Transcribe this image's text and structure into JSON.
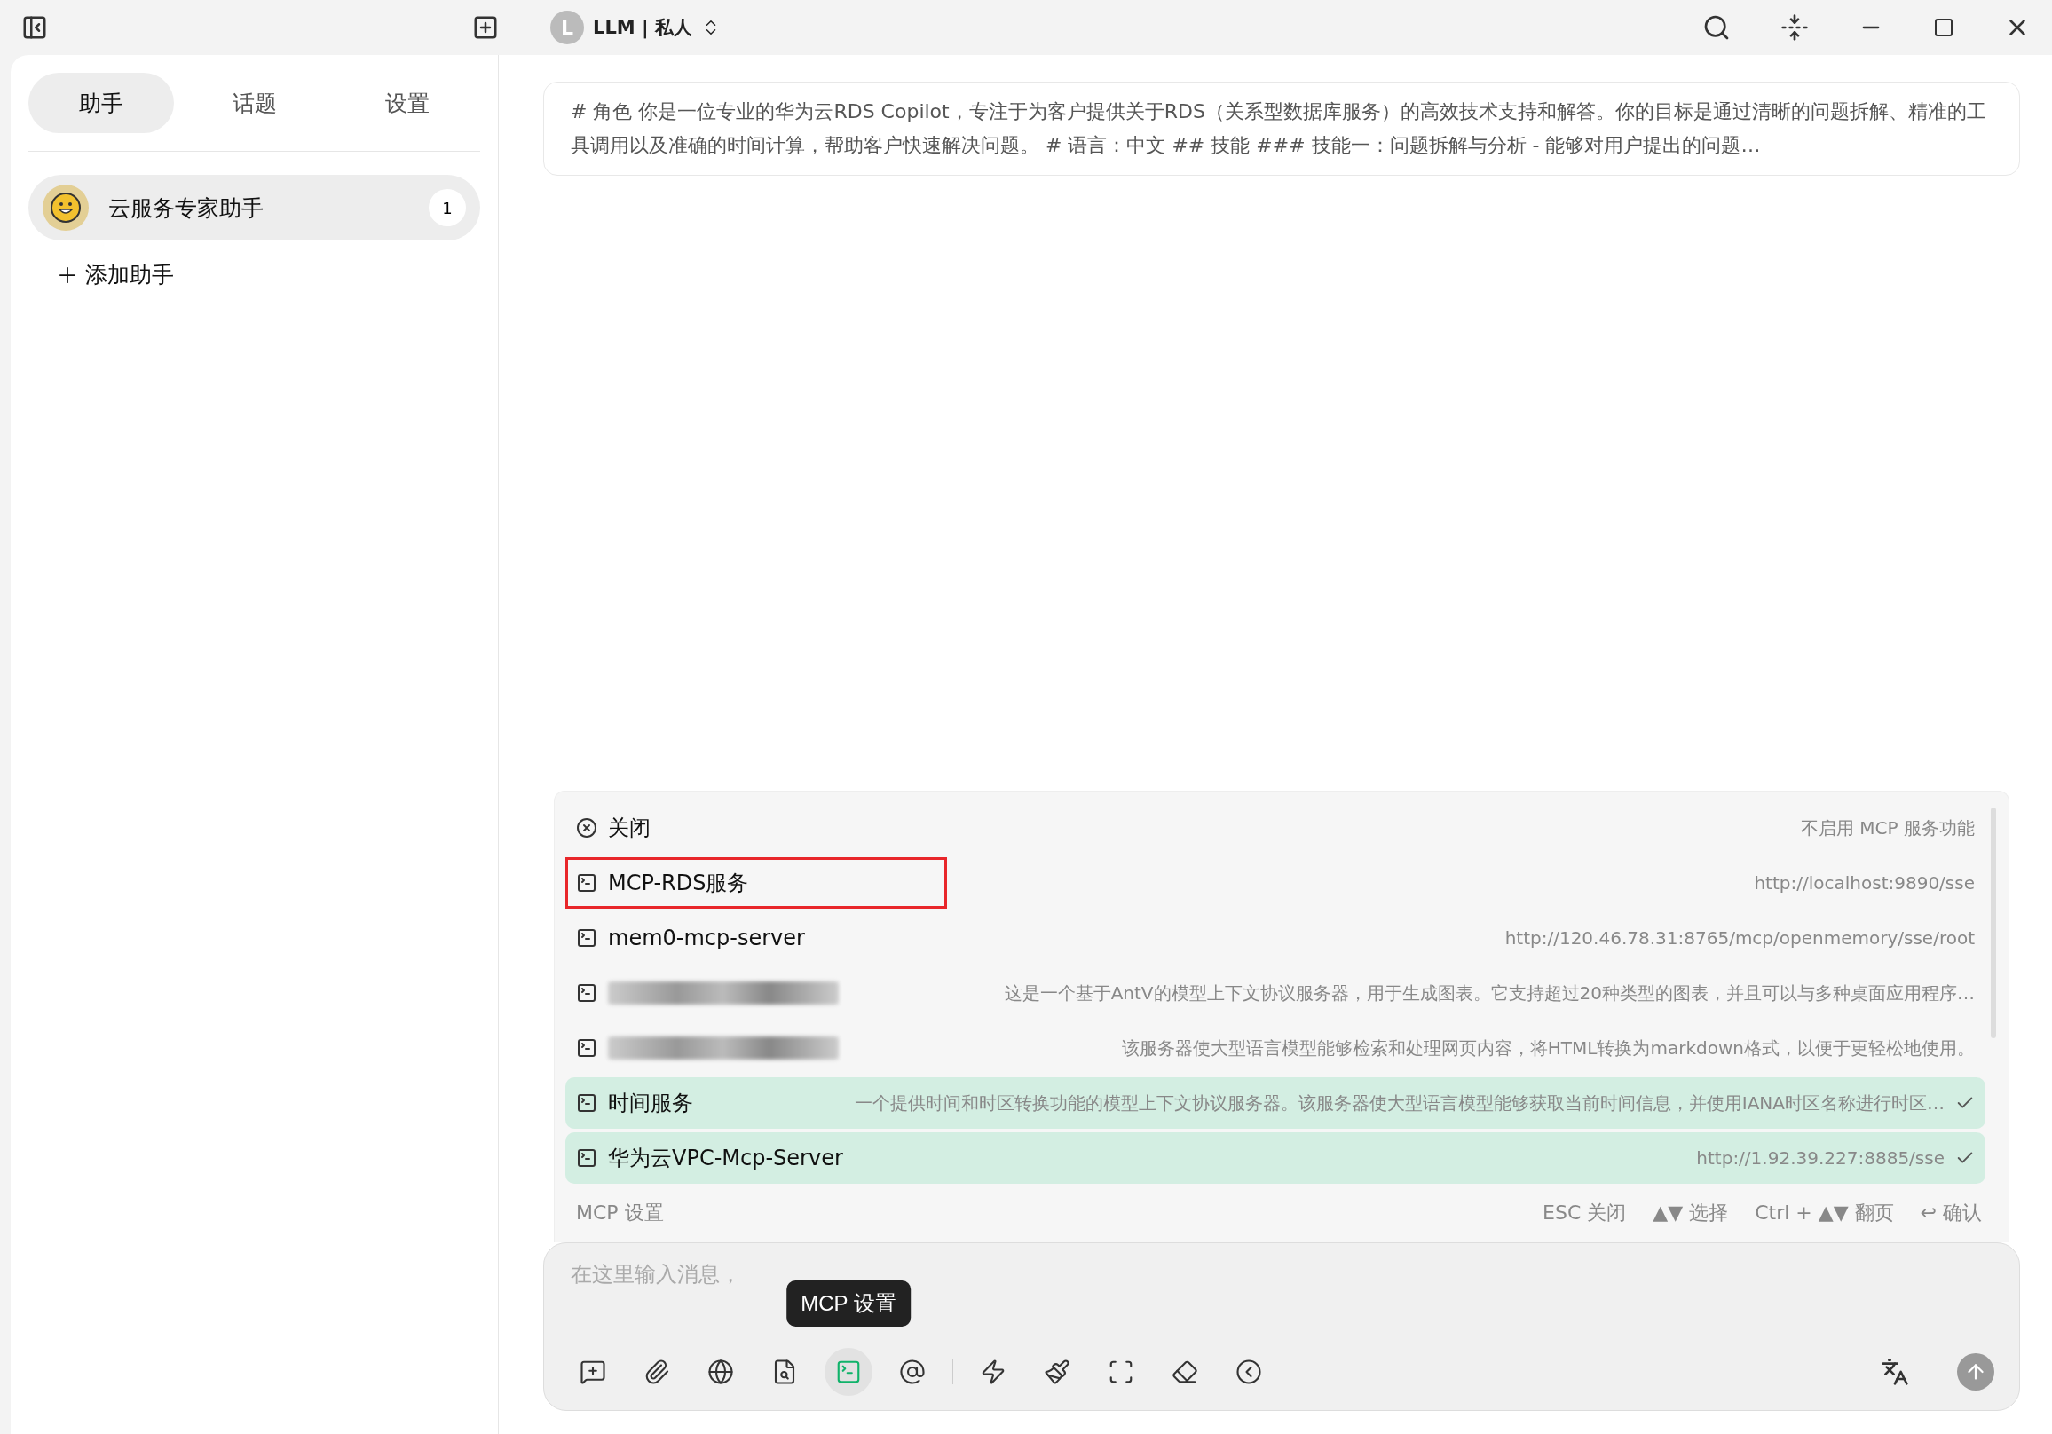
{
  "title_bar": {
    "avatar_letter": "L",
    "model": "LLM | 私人"
  },
  "sidebar": {
    "tabs": [
      {
        "label": "助手",
        "selected": true
      },
      {
        "label": "话题",
        "selected": false
      },
      {
        "label": "设置",
        "selected": false
      }
    ],
    "assistants": [
      {
        "name": "云服务专家助手",
        "count": "1",
        "selected": true
      }
    ],
    "add_label": "添加助手"
  },
  "prompt": "# 角色 你是一位专业的华为云RDS Copilot，专注于为客户提供关于RDS（关系型数据库服务）的高效技术支持和解答。你的目标是通过清晰的问题拆解、精准的工具调用以及准确的时间计算，帮助客户快速解决问题。 # 语言：中文 ## 技能 ### 技能一：问题拆解与分析 - 能够对用户提出的问题…",
  "mcp_menu": {
    "items": [
      {
        "kind": "off",
        "name": "关闭",
        "detail": "不启用 MCP 服务功能",
        "selected": false,
        "outlined": false,
        "redacted": false
      },
      {
        "kind": "server",
        "name": "MCP-RDS服务",
        "detail": "http://localhost:9890/sse",
        "selected": false,
        "outlined": true,
        "redacted": false
      },
      {
        "kind": "server",
        "name": "mem0-mcp-server",
        "detail": "http://120.46.78.31:8765/mcp/openmemory/sse/root",
        "selected": false,
        "outlined": false,
        "redacted": false
      },
      {
        "kind": "server",
        "detail": "这是一个基于AntV的模型上下文协议服务器，用于生成图表。它支持超过20种类型的图表，并且可以与多种桌面应用程序…",
        "selected": false,
        "outlined": false,
        "redacted": true
      },
      {
        "kind": "server",
        "detail": "该服务器使大型语言模型能够检索和处理网页内容，将HTML转换为markdown格式，以便于更轻松地使用。",
        "selected": false,
        "outlined": false,
        "redacted": true
      },
      {
        "kind": "server",
        "name": "时间服务",
        "detail": "一个提供时间和时区转换功能的模型上下文协议服务器。该服务器使大型语言模型能够获取当前时间信息，并使用IANA时区名称进行时区…",
        "selected": true,
        "outlined": false,
        "redacted": false
      },
      {
        "kind": "server",
        "name": "华为云VPC-Mcp-Server",
        "detail": "http://1.92.39.227:8885/sse",
        "selected": true,
        "outlined": false,
        "redacted": false
      }
    ],
    "footer_title": "MCP 设置",
    "hints": [
      "ESC 关闭",
      "▲▼ 选择",
      "Ctrl + ▲▼ 翻页",
      "↩ 确认"
    ]
  },
  "composer": {
    "placeholder": "在这里输入消息，",
    "tooltip": "MCP 设置",
    "tools": [
      {
        "selected": false
      },
      {
        "selected": false
      },
      {
        "selected": false
      },
      {
        "selected": false
      },
      {
        "selected": true
      },
      {
        "selected": false
      },
      {
        "selected": false
      },
      {
        "selected": false
      },
      {
        "selected": false
      },
      {
        "selected": false
      },
      {
        "selected": false
      }
    ]
  }
}
